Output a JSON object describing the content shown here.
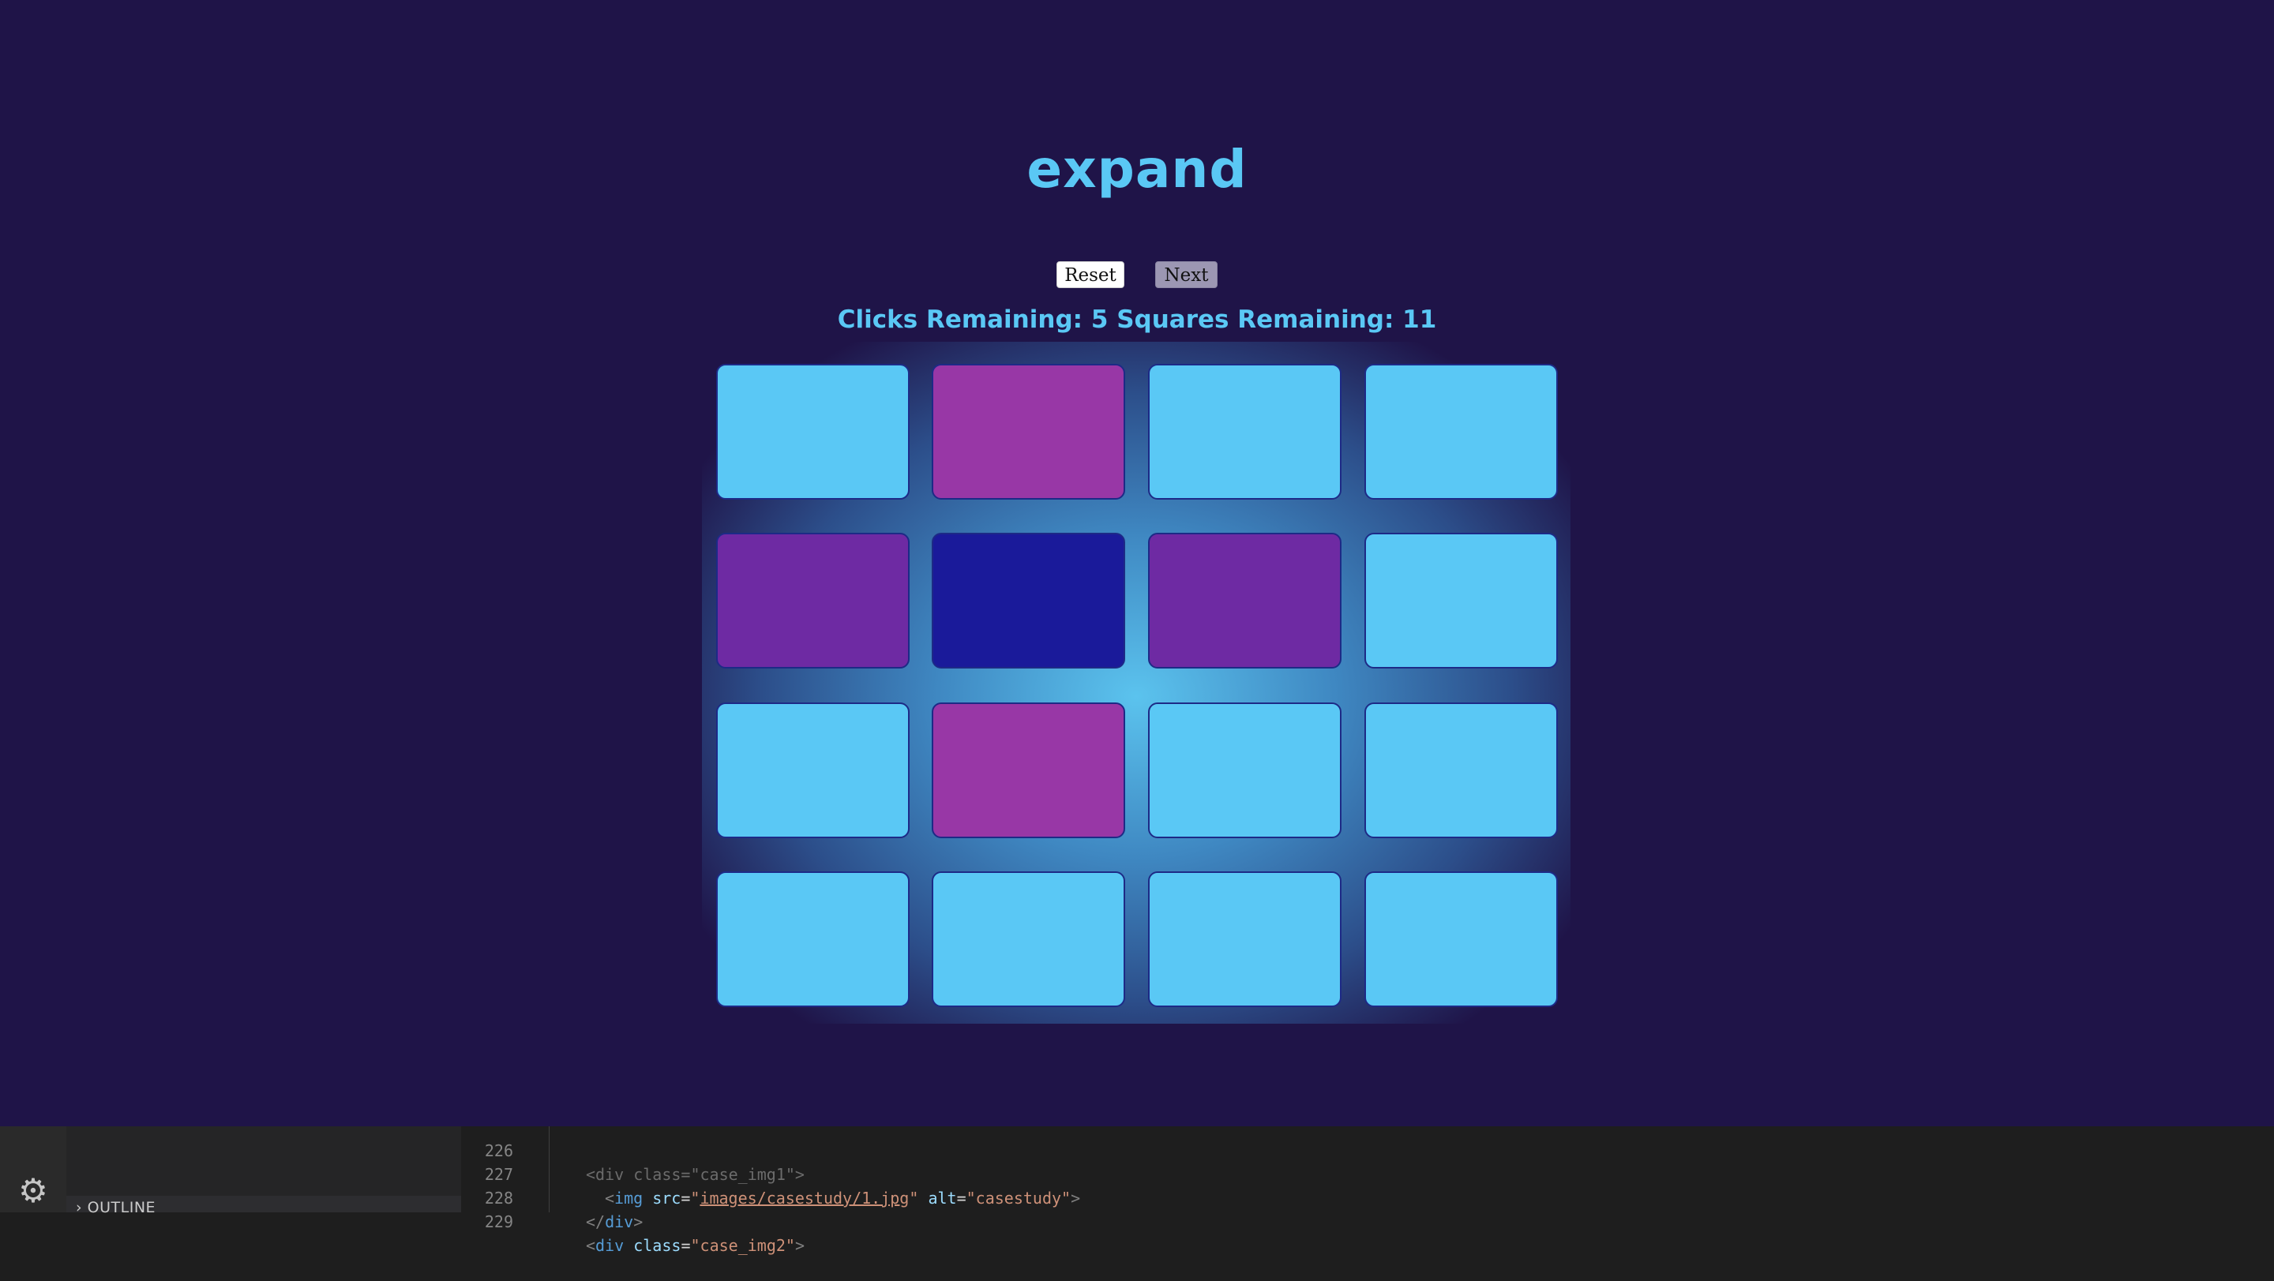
{
  "game": {
    "title": "expand",
    "reset_label": "Reset",
    "next_label": "Next",
    "status_text": "Clicks Remaining: 5 Squares Remaining: 11",
    "colors": {
      "background": "#1f1448",
      "accent": "#5ac8f5",
      "tile_light": "#5ac8f5",
      "tile_magenta": "#9837a6",
      "tile_purple": "#6e2aa3",
      "tile_blue": "#1a1a9a"
    },
    "tiles": [
      [
        "light",
        "magenta",
        "light",
        "light"
      ],
      [
        "purple",
        "blue",
        "purple",
        "light"
      ],
      [
        "light",
        "magenta",
        "light",
        "light"
      ],
      [
        "light",
        "light",
        "light",
        "light"
      ]
    ]
  },
  "editor": {
    "settings_icon": "gear-icon",
    "outline_label": "OUTLINE",
    "lines": [
      {
        "number": "226",
        "text": "<div class=\"case_img1\">"
      },
      {
        "number": "227",
        "text": "<img src=\"images/casestudy/1.jpg\" alt=\"casestudy\">"
      },
      {
        "number": "228",
        "text": "</div>"
      },
      {
        "number": "229",
        "text": "<div class=\"case_img2\">"
      }
    ]
  }
}
